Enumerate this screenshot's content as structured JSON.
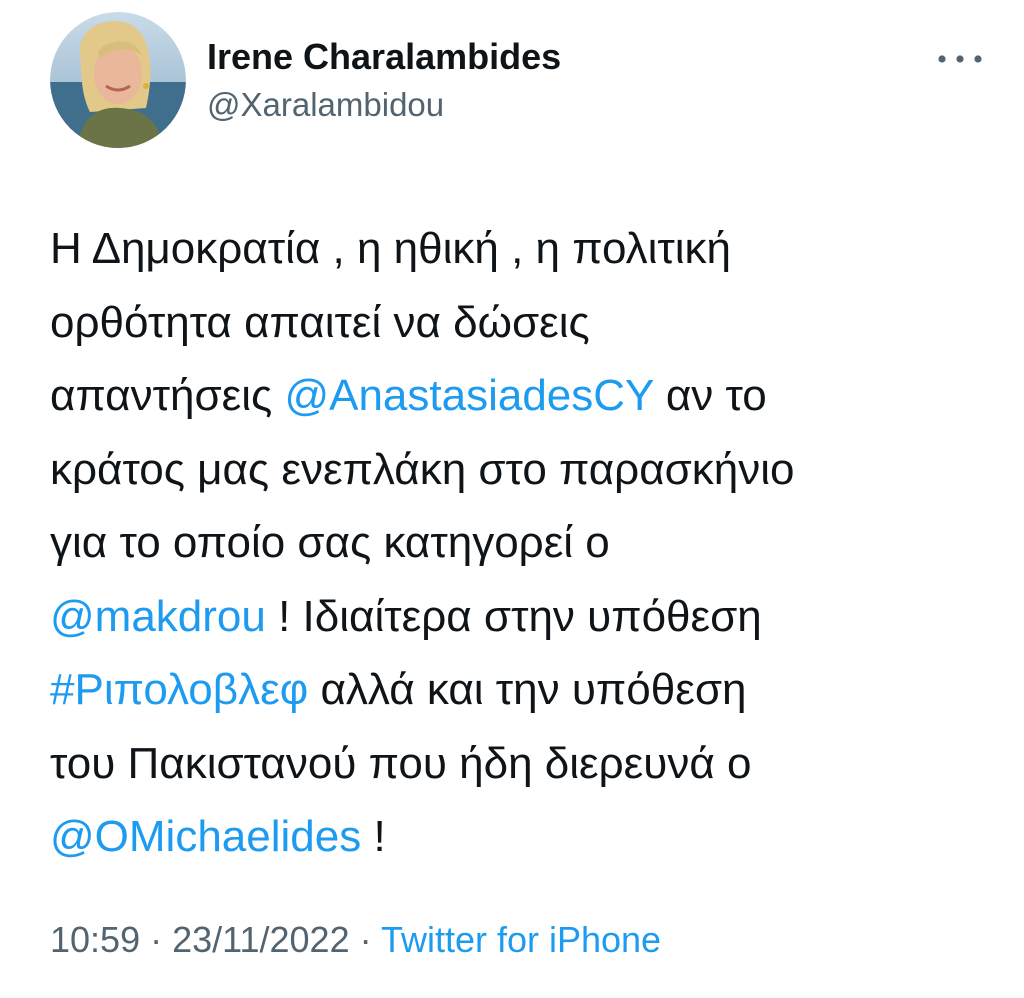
{
  "author": {
    "display_name": "Irene Charalambides",
    "handle": "@Xaralambidou",
    "avatar_icon": "profile-photo-avatar"
  },
  "more_icon": "more-horizontal-icon",
  "tweet": {
    "lines": [
      [
        {
          "t": "Η Δημοκρατία , η ηθική , η πολιτική"
        }
      ],
      [
        {
          "t": "ορθότητα απαιτεί να δώσεις"
        }
      ],
      [
        {
          "t": "απαντήσεις "
        },
        {
          "t": "@AnastasiadesCY",
          "link": true
        },
        {
          "t": " αν το"
        }
      ],
      [
        {
          "t": "κράτος μας ενεπλάκη στο παρασκήνιο"
        }
      ],
      [
        {
          "t": "για το οποίο σας κατηγορεί ο"
        }
      ],
      [
        {
          "t": "@makdrou",
          "link": true
        },
        {
          "t": " ! Ιδιαίτερα στην υπόθεση"
        }
      ],
      [
        {
          "t": "#Ριπολοβλεφ",
          "link": true
        },
        {
          "t": " αλλά και  την υπόθεση"
        }
      ],
      [
        {
          "t": "του Πακιστανού που ήδη διερευνά ο"
        }
      ],
      [
        {
          "t": "@OMichaelides",
          "link": true
        },
        {
          "t": " !"
        }
      ]
    ]
  },
  "meta": {
    "time": "10:59",
    "separator": " · ",
    "date": "23/11/2022",
    "source": "Twitter for iPhone"
  },
  "colors": {
    "link": "#1d9bf0",
    "text": "#0f1419",
    "secondary": "#536471"
  }
}
